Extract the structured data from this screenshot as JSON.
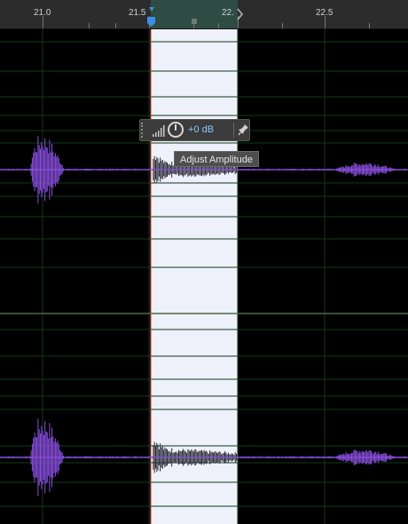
{
  "ruler": {
    "labels": [
      "21.0",
      "21.5",
      "22.",
      "22.5"
    ],
    "selection_start": "21.5",
    "selection_end": "22."
  },
  "hud": {
    "value": "+0 dB",
    "knob_icon": "volume-knob-icon",
    "meter_icon": "level-meter-icon",
    "pin_icon": "pin-icon"
  },
  "tooltip": {
    "text": "Adjust Amplitude"
  },
  "colors": {
    "waveform": "#8a4fe0",
    "selection_band": "#eef0fa",
    "grid_line": "#0f3a18",
    "playhead": "#d83a3a",
    "hud_value": "#8cc4ff"
  }
}
